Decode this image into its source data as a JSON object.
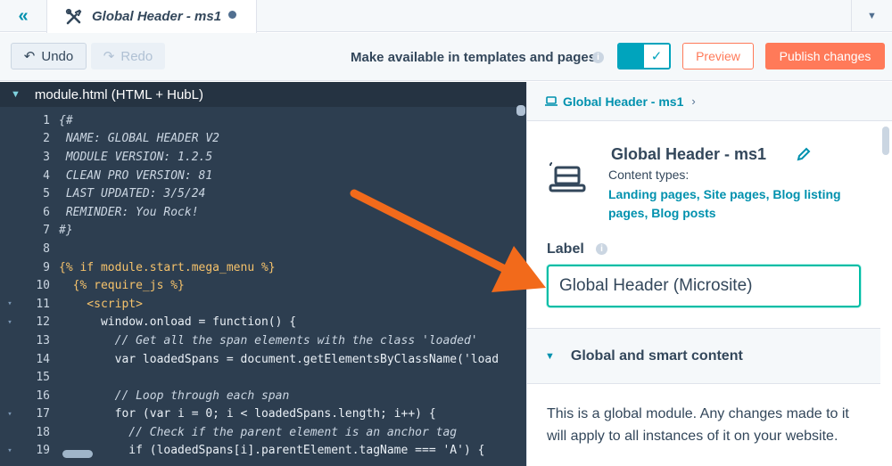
{
  "tab": {
    "title": "Global Header - ms1"
  },
  "toolbar": {
    "undo_label": "Undo",
    "redo_label": "Redo",
    "availability_label": "Make available in templates and pages",
    "preview_label": "Preview",
    "publish_label": "Publish changes"
  },
  "editor": {
    "filename": "module.html (HTML + HubL)",
    "lines": [
      {
        "n": "1",
        "text": "{#",
        "cls": "comment",
        "fold": ""
      },
      {
        "n": "2",
        "text": " NAME: GLOBAL HEADER V2",
        "cls": "comment",
        "fold": ""
      },
      {
        "n": "3",
        "text": " MODULE VERSION: 1.2.5",
        "cls": "comment",
        "fold": ""
      },
      {
        "n": "4",
        "text": " CLEAN PRO VERSION: 81",
        "cls": "comment",
        "fold": ""
      },
      {
        "n": "5",
        "text": " LAST UPDATED: 3/5/24",
        "cls": "comment",
        "fold": ""
      },
      {
        "n": "6",
        "text": " REMINDER: You Rock!",
        "cls": "comment",
        "fold": ""
      },
      {
        "n": "7",
        "text": "#}",
        "cls": "comment",
        "fold": ""
      },
      {
        "n": "8",
        "text": "",
        "cls": "plain",
        "fold": ""
      },
      {
        "n": "9",
        "text": "{% if module.start.mega_menu %}",
        "cls": "hubl",
        "fold": ""
      },
      {
        "n": "10",
        "text": "  {% require_js %}",
        "cls": "hubl",
        "fold": ""
      },
      {
        "n": "11",
        "text": "    <script>",
        "cls": "kw",
        "fold": "▾"
      },
      {
        "n": "12",
        "text": "      window.onload = function() {",
        "cls": "plain",
        "fold": "▾"
      },
      {
        "n": "13",
        "text": "        // Get all the span elements with the class 'loaded'",
        "cls": "comment",
        "fold": ""
      },
      {
        "n": "14",
        "text": "        var loadedSpans = document.getElementsByClassName('load",
        "cls": "plain",
        "fold": ""
      },
      {
        "n": "15",
        "text": "",
        "cls": "plain",
        "fold": ""
      },
      {
        "n": "16",
        "text": "        // Loop through each span",
        "cls": "comment",
        "fold": ""
      },
      {
        "n": "17",
        "text": "        for (var i = 0; i < loadedSpans.length; i++) {",
        "cls": "plain",
        "fold": "▾"
      },
      {
        "n": "18",
        "text": "          // Check if the parent element is an anchor tag",
        "cls": "comment",
        "fold": ""
      },
      {
        "n": "19",
        "text": "          if (loadedSpans[i].parentElement.tagName === 'A') {",
        "cls": "plain",
        "fold": "▾"
      }
    ]
  },
  "panel": {
    "breadcrumb": "Global Header - ms1",
    "module_title": "Global Header - ms1",
    "content_types_label": "Content types:",
    "content_types": "Landing pages, Site pages, Blog listing pages, Blog posts",
    "label_title": "Label",
    "label_value": "Global Header (Microsite)",
    "section_title": "Global and smart content",
    "section_body": "This is a global module. Any changes made to it will apply to all instances of it on your website."
  },
  "colors": {
    "accent": "#00a4bd",
    "brand_orange": "#ff7a59",
    "link": "#0091ae",
    "arrow": "#f26a1b"
  }
}
